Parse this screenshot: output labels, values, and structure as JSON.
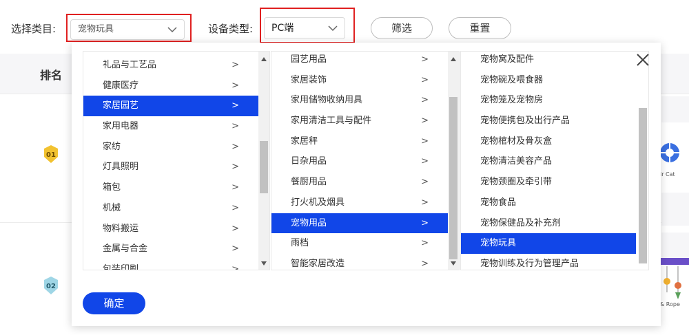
{
  "filters": {
    "category_label": "选择类目:",
    "category_value": "宠物玩具",
    "device_label": "设备类型:",
    "device_value": "PC端",
    "filter_button": "筛选",
    "reset_button": "重置"
  },
  "table": {
    "rank_header": "排名",
    "ranks": [
      "01",
      "02"
    ],
    "thumb_captions": [
      "ir Cat",
      "& Rope"
    ]
  },
  "dropdown": {
    "level1": [
      {
        "label": "礼品与工艺品",
        "arrow": ">"
      },
      {
        "label": "健康医疗",
        "arrow": ">"
      },
      {
        "label": "家居园艺",
        "arrow": ">",
        "active": true
      },
      {
        "label": "家用电器",
        "arrow": ">"
      },
      {
        "label": "家纺",
        "arrow": ">"
      },
      {
        "label": "灯具照明",
        "arrow": ">"
      },
      {
        "label": "箱包",
        "arrow": ">"
      },
      {
        "label": "机械",
        "arrow": ">"
      },
      {
        "label": "物料搬运",
        "arrow": ">"
      },
      {
        "label": "金属与合金",
        "arrow": ">"
      },
      {
        "label": "包装印刷",
        "arrow": ">"
      }
    ],
    "level2": [
      {
        "label": "园艺用品",
        "arrow": ">"
      },
      {
        "label": "家居装饰",
        "arrow": ">"
      },
      {
        "label": "家用储物收纳用具",
        "arrow": ">"
      },
      {
        "label": "家用清洁工具与配件",
        "arrow": ">"
      },
      {
        "label": "家居秤",
        "arrow": ">"
      },
      {
        "label": "日杂用品",
        "arrow": ">"
      },
      {
        "label": "餐厨用品",
        "arrow": ">"
      },
      {
        "label": "打火机及烟具",
        "arrow": ">"
      },
      {
        "label": "宠物用品",
        "arrow": ">",
        "active": true
      },
      {
        "label": "雨档",
        "arrow": ">"
      },
      {
        "label": "智能家居改造",
        "arrow": ">"
      }
    ],
    "level3": [
      {
        "label": "宠物窝及配件"
      },
      {
        "label": "宠物碗及喂食器"
      },
      {
        "label": "宠物笼及宠物房"
      },
      {
        "label": "宠物便携包及出行产品"
      },
      {
        "label": "宠物棺材及骨灰盒"
      },
      {
        "label": "宠物清洁美容产品"
      },
      {
        "label": "宠物颈圈及牵引带"
      },
      {
        "label": "宠物食品"
      },
      {
        "label": "宠物保健品及补充剂"
      },
      {
        "label": "宠物玩具",
        "active": true
      },
      {
        "label": "宠物训练及行为管理产品"
      }
    ],
    "confirm_button": "确定",
    "close_icon": "close-icon"
  },
  "colors": {
    "accent": "#1146e8",
    "highlight_box": "#e02020",
    "rank_badge_gold": "#f2c230",
    "rank_badge_silver": "#9fd6e6"
  }
}
